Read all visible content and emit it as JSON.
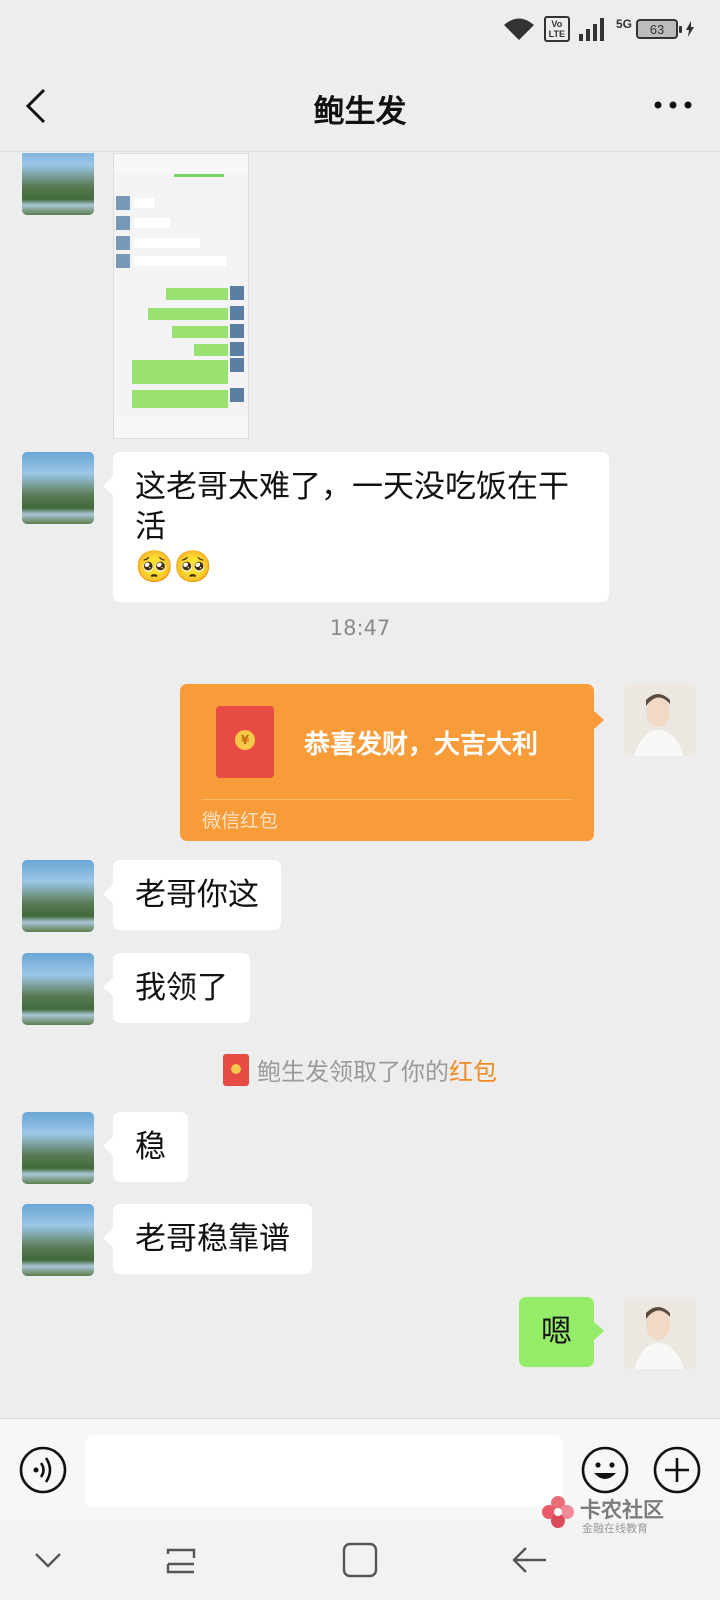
{
  "status_bar": {
    "volte_top": "Vo",
    "volte_bottom": "LTE",
    "network": "5G",
    "battery": "63"
  },
  "header": {
    "title": "鲍生发"
  },
  "messages": {
    "m1": {
      "line1": "这老哥太难了，一天没吃饭在干活",
      "emoji": "🥺🥺"
    },
    "time": "18:47",
    "red_packet": {
      "title": "恭喜发财，大吉大利",
      "footer": "微信红包"
    },
    "m2": "老哥你这",
    "m3": "我领了",
    "system": {
      "prefix": "鲍生发领取了你的",
      "highlight": "红包"
    },
    "m4": "稳",
    "m5": "老哥稳靠谱",
    "m6": "嗯"
  },
  "input": {
    "value": ""
  },
  "watermark": {
    "title": "卡农社区",
    "subtitle": "金融在线教育"
  },
  "colors": {
    "background": "#ededed",
    "bubble_self": "#95ec69",
    "red_packet": "#f79c39",
    "highlight": "#f08a23"
  }
}
